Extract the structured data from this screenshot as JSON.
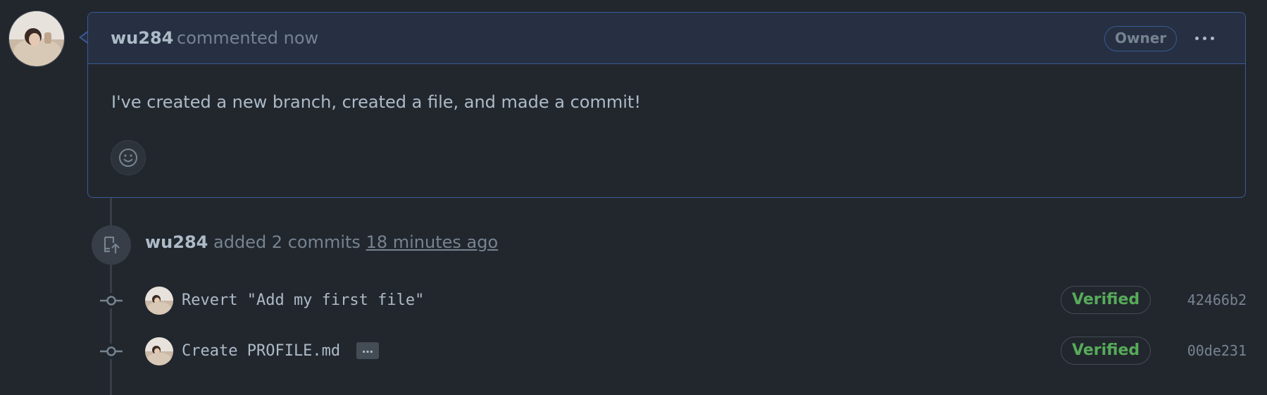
{
  "comment": {
    "author": "wu284",
    "action": "commented now",
    "badge": "Owner",
    "body": "I've created a new branch, created a file, and made a commit!",
    "icons": {
      "more": "kebab-horizontal-icon",
      "reaction": "smiley-icon"
    }
  },
  "event": {
    "author": "wu284",
    "action": "added 2 commits",
    "time": "18 minutes ago",
    "icon": "repo-push-icon"
  },
  "commits": [
    {
      "message": "Revert \"Add my first file\"",
      "status": "Verified",
      "sha": "42466b2",
      "has_ellipsis": false
    },
    {
      "message": "Create PROFILE.md",
      "status": "Verified",
      "sha": "00de231",
      "has_ellipsis": true,
      "ellipsis_label": "…"
    }
  ],
  "colors": {
    "background": "#22272e",
    "accent_border": "#3b5a95",
    "verified": "#57ab5a",
    "muted": "#768390"
  }
}
